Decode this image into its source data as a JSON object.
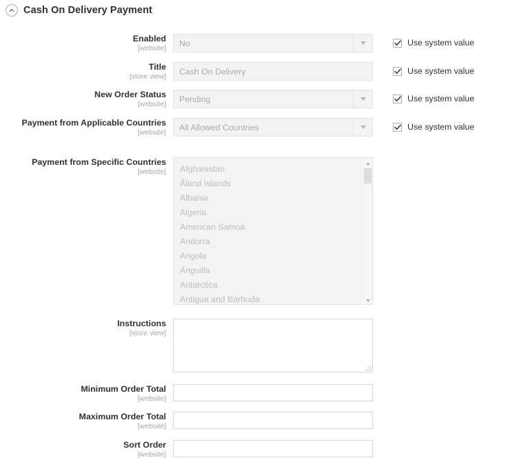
{
  "section": {
    "title": "Cash On Delivery Payment",
    "collapse_icon": "chevron-up-circle-icon"
  },
  "use_system_value_label": "Use system value",
  "scope_website": "[website]",
  "scope_store_view": "[store view]",
  "fields": {
    "enabled": {
      "label": "Enabled",
      "scope": "[website]",
      "value": "No",
      "use_system_value": true
    },
    "title": {
      "label": "Title",
      "scope": "[store view]",
      "value": "Cash On Delivery",
      "use_system_value": true
    },
    "new_order_status": {
      "label": "New Order Status",
      "scope": "[website]",
      "value": "Pending",
      "use_system_value": true
    },
    "applicable_countries": {
      "label": "Payment from Applicable Countries",
      "scope": "[website]",
      "value": "All Allowed Countries",
      "use_system_value": true
    },
    "specific_countries": {
      "label": "Payment from Specific Countries",
      "scope": "[website]",
      "options": [
        "Afghanistan",
        "Åland Islands",
        "Albania",
        "Algeria",
        "American Samoa",
        "Andorra",
        "Angola",
        "Anguilla",
        "Antarctica",
        "Antigua and Barbuda"
      ]
    },
    "instructions": {
      "label": "Instructions",
      "scope": "[store view]",
      "value": ""
    },
    "minimum_order_total": {
      "label": "Minimum Order Total",
      "scope": "[website]",
      "value": ""
    },
    "maximum_order_total": {
      "label": "Maximum Order Total",
      "scope": "[website]",
      "value": ""
    },
    "sort_order": {
      "label": "Sort Order",
      "scope": "[website]",
      "value": ""
    }
  },
  "colors": {
    "text": "#303030",
    "muted": "#a6a6a6",
    "disabled_bg": "#f3f3f3",
    "border": "#d6d6d6"
  }
}
